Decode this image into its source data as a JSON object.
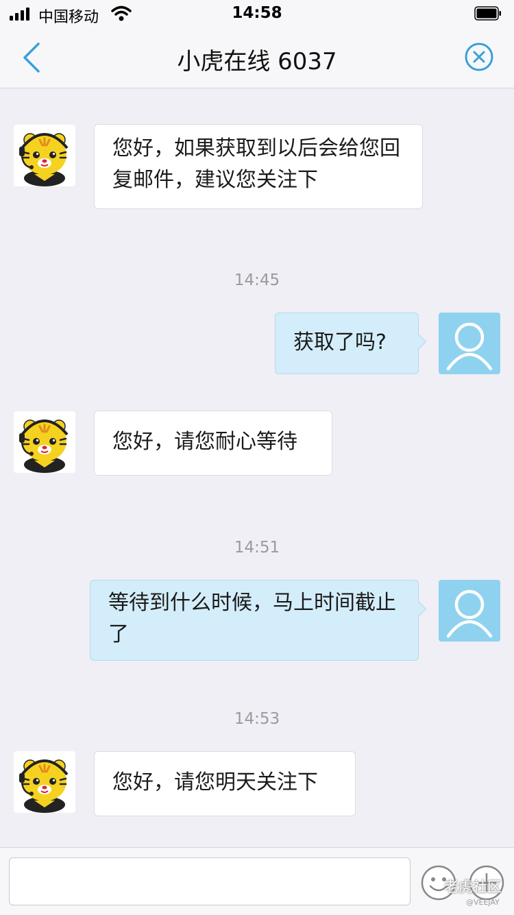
{
  "status_bar": {
    "carrier": "中国移动",
    "time": "14:58"
  },
  "nav": {
    "title": "小虎在线 6037",
    "back_icon": "chevron-left-icon",
    "close_icon": "close-circle-icon"
  },
  "messages": [
    {
      "direction": "in",
      "text": "您好，如果获取到以后会给您回复邮件，建议您关注下"
    },
    {
      "direction": "out",
      "text": "获取了吗?"
    },
    {
      "direction": "in",
      "text": "您好，请您耐心等待"
    },
    {
      "direction": "out",
      "text": "等待到什么时候，马上时间截止了"
    },
    {
      "direction": "in",
      "text": "您好，请您明天关注下"
    }
  ],
  "timestamps": [
    "14:45",
    "14:51",
    "14:53"
  ],
  "input": {
    "value": "",
    "placeholder": ""
  },
  "watermark": {
    "text": "老虎社区",
    "handle": "@VEEJAY"
  },
  "colors": {
    "accent": "#3a9fd8",
    "bubble_out": "#d4edfa",
    "bubble_in": "#ffffff",
    "background": "#f0eff5",
    "user_avatar": "#8fd2ef"
  }
}
